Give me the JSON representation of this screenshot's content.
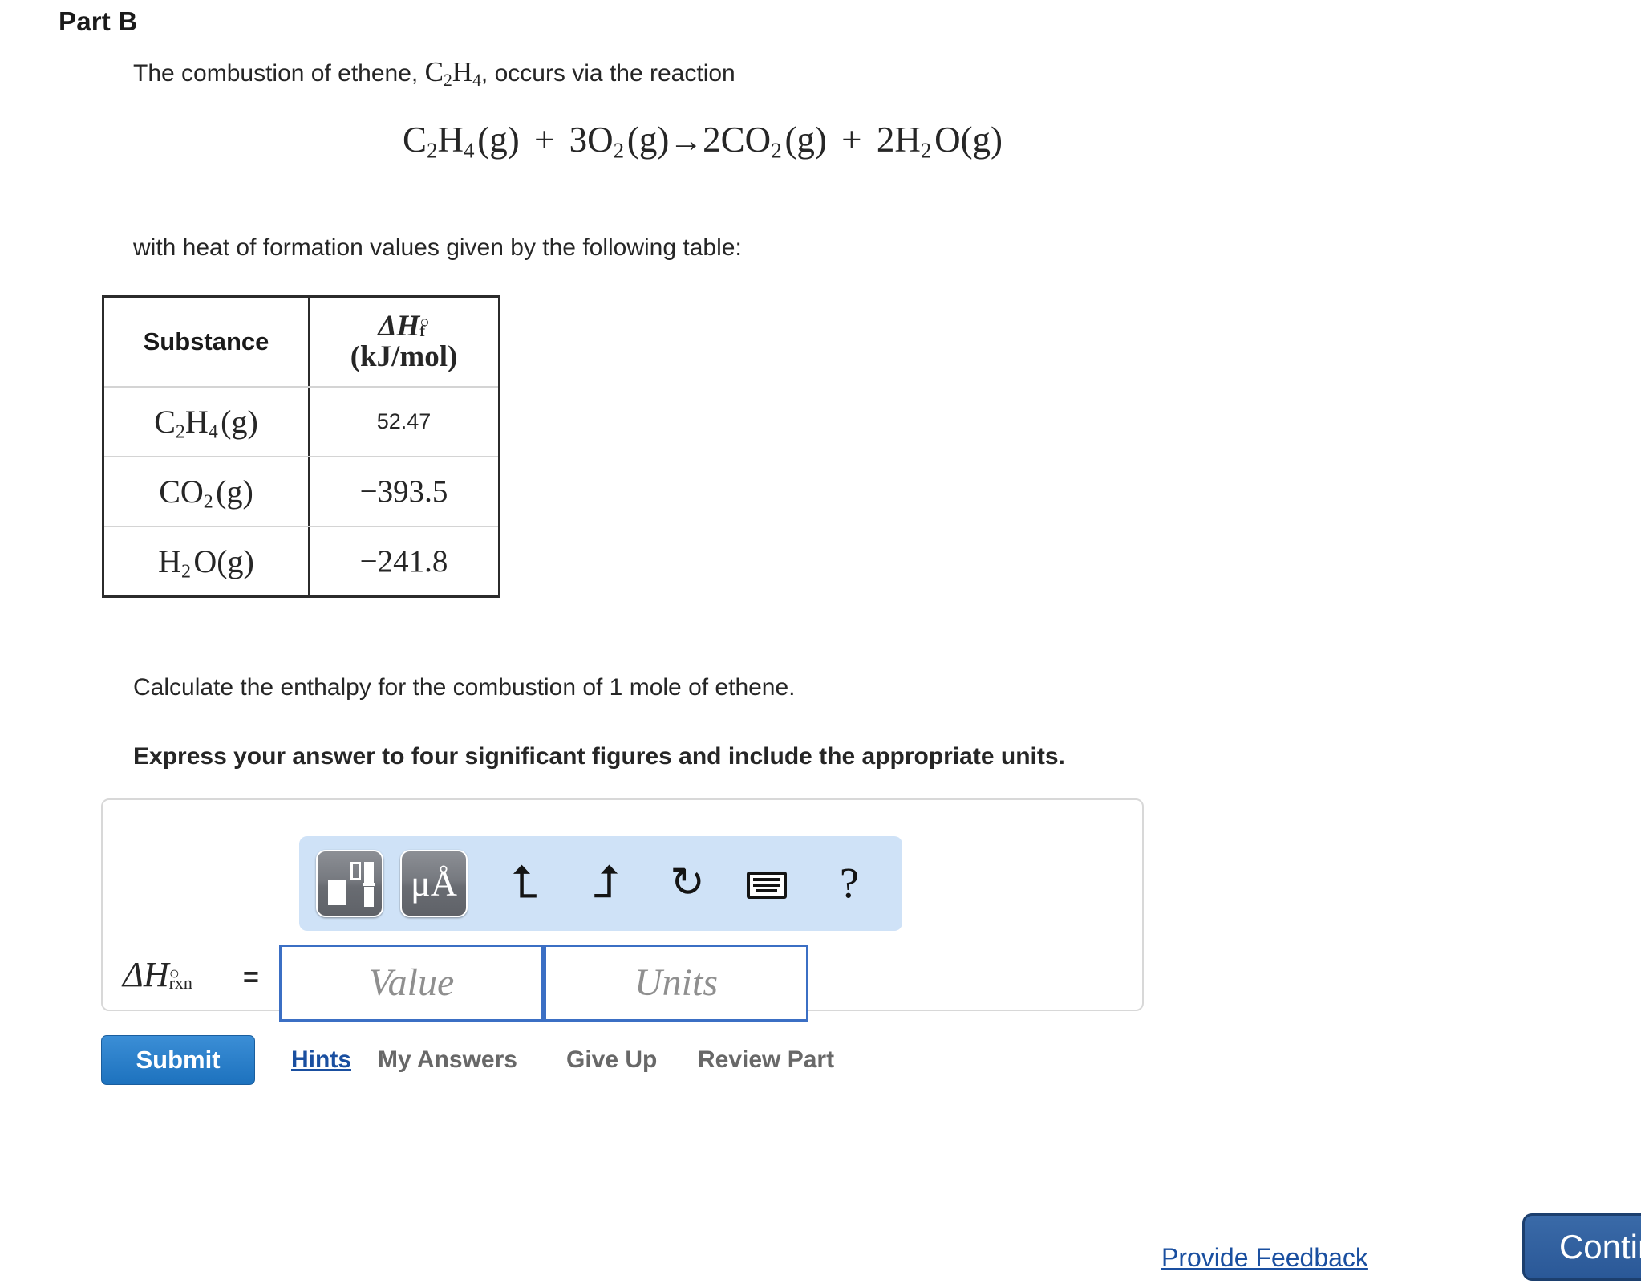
{
  "part": {
    "heading": "Part B"
  },
  "prompt": {
    "intro_before": "The combustion of ethene,",
    "intro_formula_parts": [
      "C",
      "2",
      "H",
      "4"
    ],
    "intro_after": ", occurs via the reaction",
    "table_lead": "with heat of formation values given by the following table:",
    "calculate": "Calculate the enthalpy for the combustion of 1 mole of ethene.",
    "instruction": "Express your answer to four significant figures and include the appropriate units."
  },
  "equation": {
    "reactant1": "C2H4(g)",
    "plus1": "+",
    "reactant2": "3O2(g)",
    "arrow": "→",
    "product1": "2CO2(g)",
    "plus2": "+",
    "product2": "2H2O(g)"
  },
  "table": {
    "headers": {
      "substance": "Substance",
      "delta": "ΔH",
      "delta_sup": "○",
      "delta_sub": "f",
      "units": "(kJ/mol)"
    },
    "rows": [
      {
        "substance_html": "C2H4 (g)",
        "value": "52.47"
      },
      {
        "substance_html": "CO2 (g)",
        "value": "−393.5"
      },
      {
        "substance_html": "H2O(g)",
        "value": "−241.8"
      }
    ]
  },
  "answer": {
    "label_delta": "ΔH",
    "label_sup": "○",
    "label_sub": "rxn",
    "equals": "=",
    "value_placeholder": "Value",
    "units_placeholder": "Units",
    "toolbar": {
      "template_icon": "template-icon",
      "units_button_label": "μÅ",
      "undo_icon": "⮤",
      "redo_icon": "⮥",
      "reset_icon": "↻",
      "keyboard_icon": "keyboard-icon",
      "help_icon": "?"
    }
  },
  "actions": {
    "submit": "Submit",
    "hints": "Hints",
    "my_answers": "My Answers",
    "give_up": "Give Up",
    "review_part": "Review Part"
  },
  "footer": {
    "feedback": "Provide Feedback",
    "continue": "Continue"
  },
  "colors": {
    "accent_blue": "#1d72be",
    "link_blue": "#1a4fa0",
    "toolbar_bg": "#cfe2f7",
    "field_border": "#3b6fc4",
    "continue_blue": "#2a5897"
  }
}
